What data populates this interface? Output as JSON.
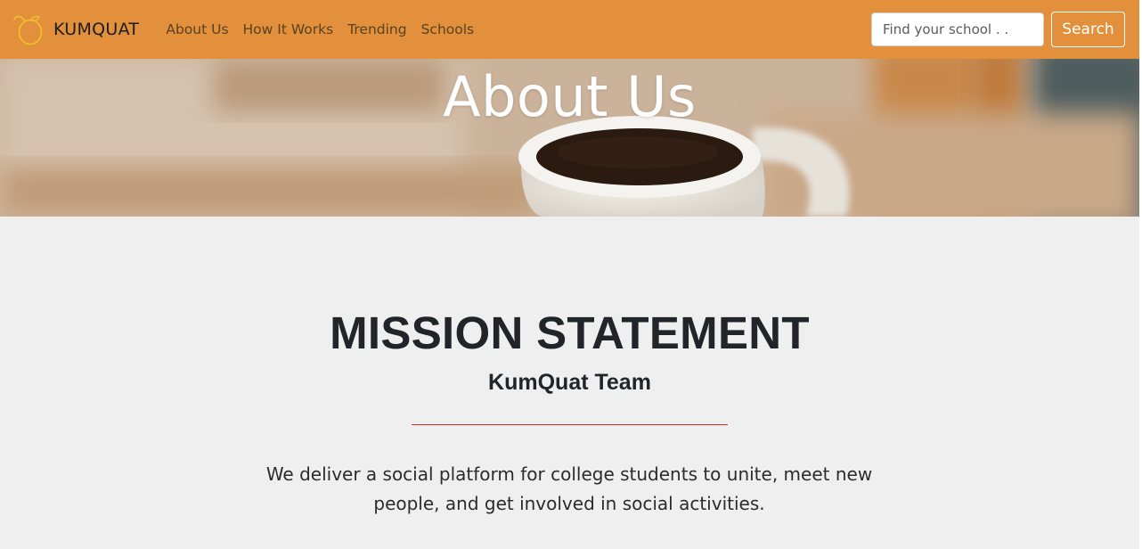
{
  "navbar": {
    "brand_name": "KUMQUAT",
    "brand_icon": "kumquat-fruit-icon",
    "links": [
      {
        "label": "About Us"
      },
      {
        "label": "How It Works"
      },
      {
        "label": "Trending"
      },
      {
        "label": "Schools"
      }
    ],
    "search": {
      "placeholder": "Find your school . .",
      "value": "",
      "button_label": "Search"
    }
  },
  "hero": {
    "title": "About Us"
  },
  "mission": {
    "title": "MISSION STATEMENT",
    "subtitle": "KumQuat Team",
    "text": "We deliver a social platform for college students to unite, meet new people, and get involved in social activities."
  },
  "colors": {
    "navbar_bg": "#e2903c",
    "page_bg": "#efefef",
    "divider": "#c9302c",
    "heading": "#212529"
  }
}
